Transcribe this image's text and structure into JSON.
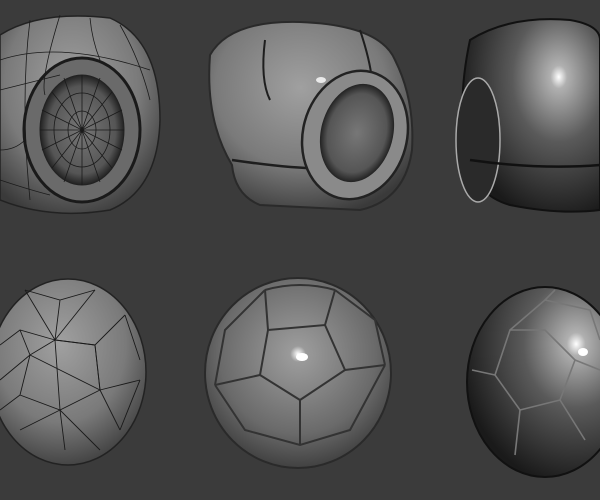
{
  "colors": {
    "background": "#3b3b3b",
    "surface_light": "#9a9a9a",
    "surface_mid": "#6e6e6e",
    "surface_dark": "#1e1e1e",
    "wire": "#1a1a1a"
  },
  "models": [
    {
      "name": "cap-wireframe",
      "row": "top",
      "style": "wireframe"
    },
    {
      "name": "cap-smooth",
      "row": "top",
      "style": "shaded"
    },
    {
      "name": "cap-smooth-glossy",
      "row": "top",
      "style": "glossy"
    },
    {
      "name": "soccer-ball-wireframe",
      "row": "bottom",
      "style": "wireframe"
    },
    {
      "name": "soccer-ball-smooth",
      "row": "bottom",
      "style": "shaded"
    },
    {
      "name": "soccer-ball-glossy",
      "row": "bottom",
      "style": "glossy"
    }
  ]
}
